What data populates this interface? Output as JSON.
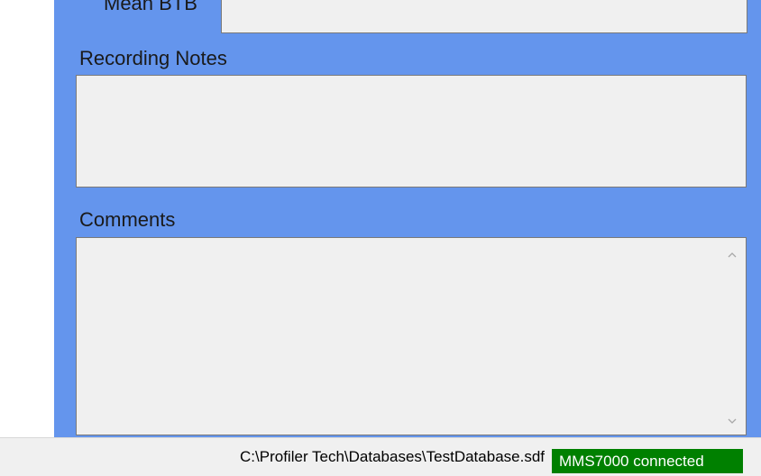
{
  "form": {
    "mean_btb_label": "Mean BTB",
    "mean_btb_value": "",
    "recording_notes_label": "Recording Notes",
    "recording_notes_value": "",
    "comments_label": "Comments",
    "comments_value": ""
  },
  "icons": {
    "scroll_up": "chevron-up-icon",
    "scroll_down": "chevron-down-icon"
  },
  "status_bar": {
    "database_path": "C:\\Profiler Tech\\Databases\\TestDatabase.sdf",
    "connection_status": "MMS7000 connected"
  },
  "colors": {
    "panel_bg": "#6495ed",
    "field_bg": "#f0f0f0",
    "status_connected": "#008000"
  }
}
